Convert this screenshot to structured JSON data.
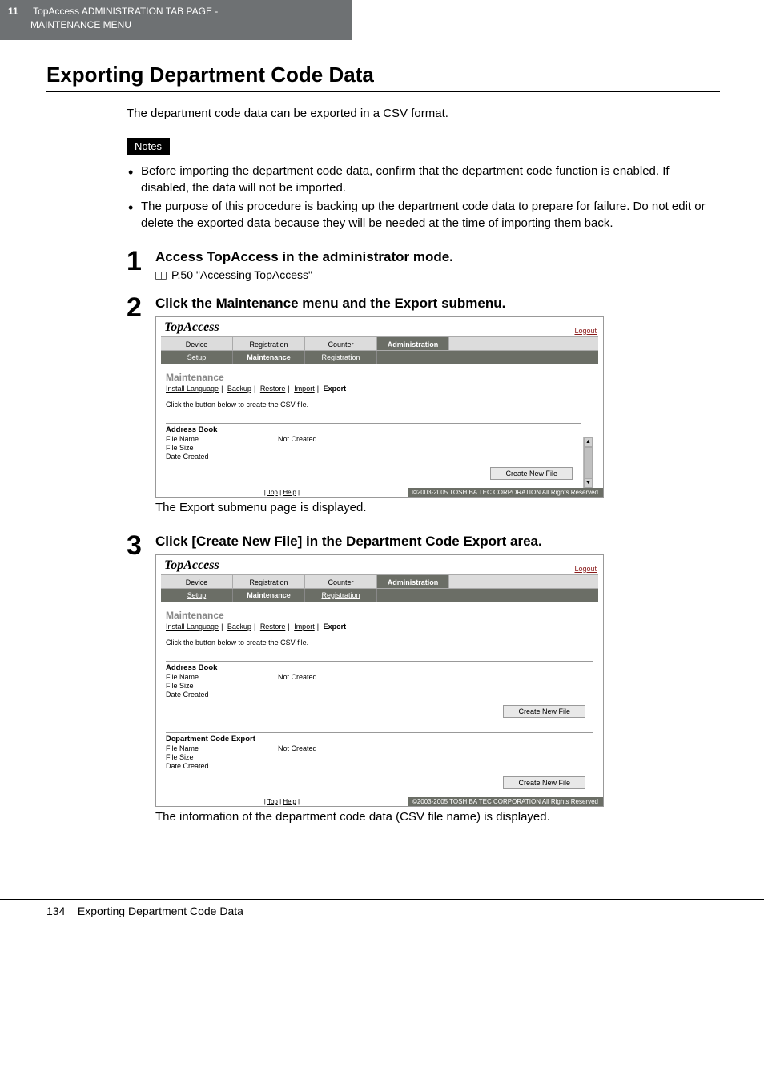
{
  "header": {
    "chapter_num": "11",
    "chapter_title_line1": "TopAccess ADMINISTRATION TAB PAGE -",
    "chapter_title_line2": "MAINTENANCE MENU"
  },
  "title": "Exporting Department Code Data",
  "intro": "The department code data can be exported in a CSV format.",
  "notes_label": "Notes",
  "notes": [
    "Before importing the department code data, confirm that the department code function is enabled. If disabled, the data will not be imported.",
    "The purpose of this procedure is backing up the department code data to prepare for failure. Do not edit or delete the exported data because they will be needed at the time of importing them back."
  ],
  "steps": {
    "s1": {
      "num": "1",
      "title": "Access TopAccess in the administrator mode.",
      "ref": "P.50 \"Accessing TopAccess\""
    },
    "s2": {
      "num": "2",
      "title": "Click the Maintenance menu and the Export submenu.",
      "caption": "The Export submenu page is displayed."
    },
    "s3": {
      "num": "3",
      "title": "Click [Create New File] in the Department Code Export area.",
      "caption": "The information of the department code data (CSV file name) is displayed."
    }
  },
  "ta": {
    "logo": "TopAccess",
    "logout": "Logout",
    "tabs": [
      "Device",
      "Registration",
      "Counter",
      "Administration"
    ],
    "active_tab": "Administration",
    "subtabs": [
      "Setup",
      "Maintenance",
      "Registration"
    ],
    "active_subtab": "Maintenance",
    "maint_heading": "Maintenance",
    "maint_links": [
      "Install Language",
      "Backup",
      "Restore",
      "Import",
      "Export"
    ],
    "maint_current": "Export",
    "desc": "Click the button below to create the CSV file.",
    "sections": {
      "address_book": {
        "title": "Address Book",
        "file_name_label": "File Name",
        "file_name_value": "Not Created",
        "file_size_label": "File Size",
        "date_created_label": "Date Created"
      },
      "dept_code": {
        "title": "Department Code Export",
        "file_name_label": "File Name",
        "file_name_value": "Not Created",
        "file_size_label": "File Size",
        "date_created_label": "Date Created"
      }
    },
    "button": "Create New File",
    "foot_top": "Top",
    "foot_help": "Help",
    "copyright": "©2003-2005 TOSHIBA TEC CORPORATION All Rights Reserved"
  },
  "footer": {
    "page_num": "134",
    "title": "Exporting Department Code Data"
  }
}
